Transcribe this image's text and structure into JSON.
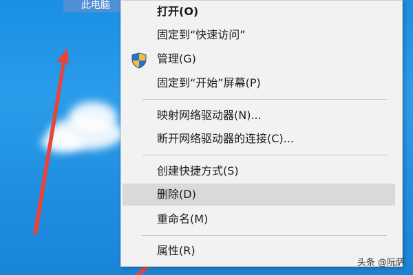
{
  "desktop": {
    "icon_label": "此电脑"
  },
  "context_menu": {
    "items": [
      {
        "label": "打开(O)"
      },
      {
        "label": "固定到“快速访问”"
      },
      {
        "label": "管理(G)"
      },
      {
        "label": "固定到“开始”屏幕(P)"
      },
      {
        "label": "映射网络驱动器(N)..."
      },
      {
        "label": "断开网络驱动器的连接(C)..."
      },
      {
        "label": "创建快捷方式(S)"
      },
      {
        "label": "删除(D)"
      },
      {
        "label": "重命名(M)"
      },
      {
        "label": "属性(R)"
      }
    ]
  },
  "icons": {
    "shield": "shield-icon",
    "arrows": "red-arrow-icon"
  },
  "colors": {
    "desktop_blue": "#1a8fe3",
    "menu_bg": "#f2f2f2",
    "highlight": "#d9d9d9",
    "arrow_red": "#e8443a"
  },
  "watermark": "头条 @阮萨"
}
